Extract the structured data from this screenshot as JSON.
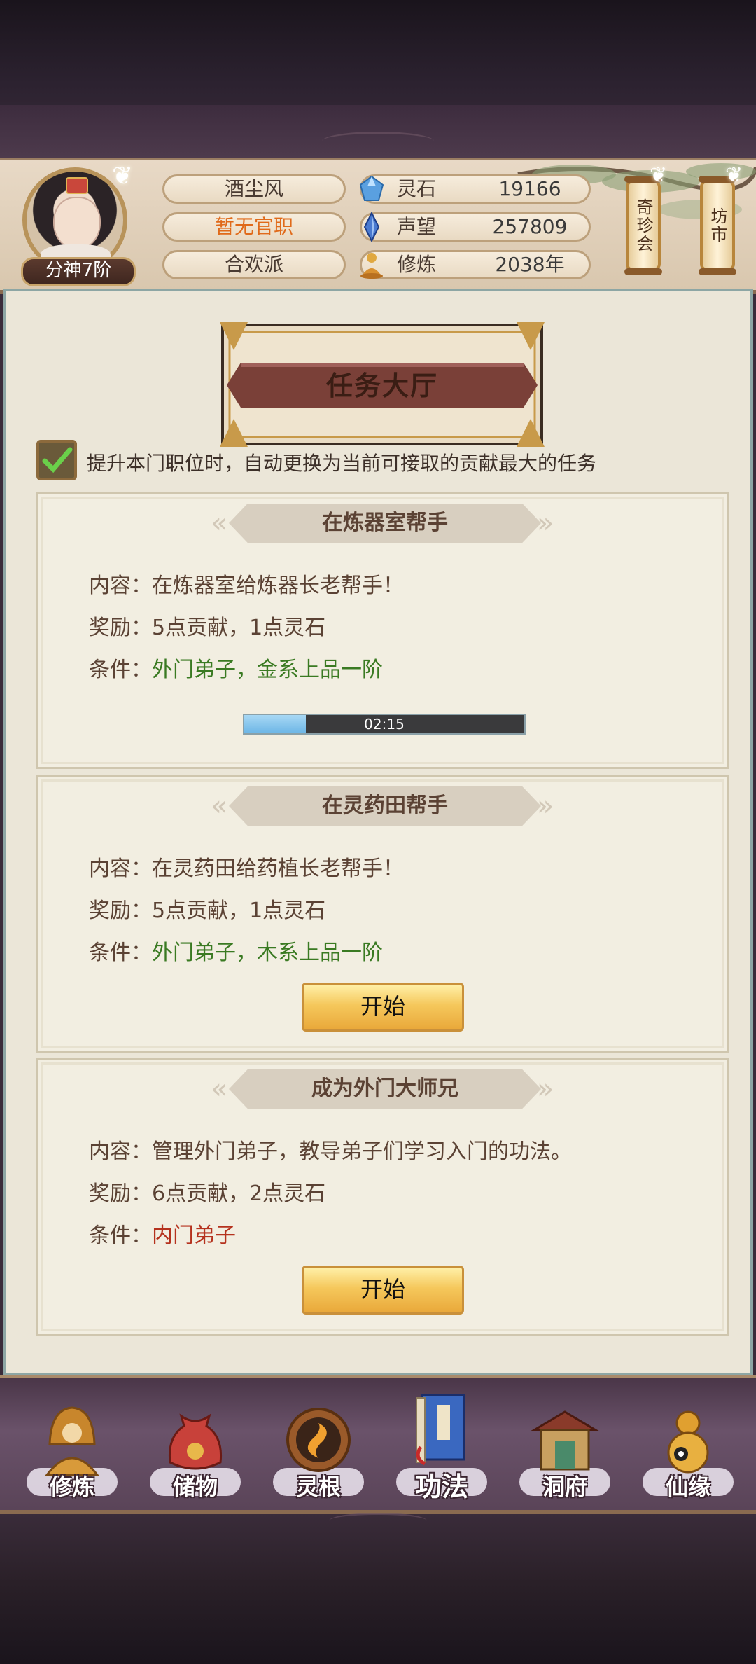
{
  "header": {
    "realm_badge": "分神7阶",
    "player_name": "酒尘风",
    "official_title": "暂无官职",
    "sect": "合欢派",
    "stats": [
      {
        "icon": "spirit-stone-icon",
        "label": "灵石",
        "value": "19166"
      },
      {
        "icon": "reputation-crystal-icon",
        "label": "声望",
        "value": "257809"
      },
      {
        "icon": "cultivation-meditate-icon",
        "label": "修炼",
        "value": "2038年"
      }
    ],
    "side_buttons": [
      {
        "label": "奇珍会"
      },
      {
        "label": "坊市"
      }
    ]
  },
  "panel": {
    "title": "任务大厅",
    "auto_switch_checked": true,
    "auto_switch_label": "提升本门职位时，自动更换为当前可接取的贡献最大的任务"
  },
  "tasks": [
    {
      "title": "在炼器室帮手",
      "content_label": "内容：",
      "content": "在炼器室给炼器长老帮手！",
      "reward_label": "奖励：",
      "reward": "5点贡献，1点灵石",
      "condition_label": "条件：",
      "condition": "外门弟子，金系上品一阶",
      "condition_met": true,
      "timer": "02:15",
      "progress": 0.22
    },
    {
      "title": "在灵药田帮手",
      "content_label": "内容：",
      "content": "在灵药田给药植长老帮手！",
      "reward_label": "奖励：",
      "reward": "5点贡献，1点灵石",
      "condition_label": "条件：",
      "condition": "外门弟子，木系上品一阶",
      "condition_met": true,
      "button": "开始"
    },
    {
      "title": "成为外门大师兄",
      "content_label": "内容：",
      "content": "管理外门弟子，教导弟子们学习入门的功法。",
      "reward_label": "奖励：",
      "reward": "6点贡献，2点灵石",
      "condition_label": "条件：",
      "condition": "内门弟子",
      "condition_met": false,
      "button": "开始"
    }
  ],
  "bottom_nav": [
    {
      "label": "修炼",
      "icon": "meditating-monk-icon"
    },
    {
      "label": "储物",
      "icon": "storage-bag-icon"
    },
    {
      "label": "灵根",
      "icon": "spirit-root-icon"
    },
    {
      "label": "功法",
      "icon": "technique-book-icon",
      "active": true
    },
    {
      "label": "洞府",
      "icon": "cave-dwelling-icon"
    },
    {
      "label": "仙缘",
      "icon": "gourd-icon"
    }
  ],
  "colors": {
    "condition_met": "#3a7a22",
    "condition_unmet": "#b5321e",
    "official_title": "#e06a1a",
    "progress_fill": "#6cb6e6",
    "start_button": "#f5c85c"
  }
}
